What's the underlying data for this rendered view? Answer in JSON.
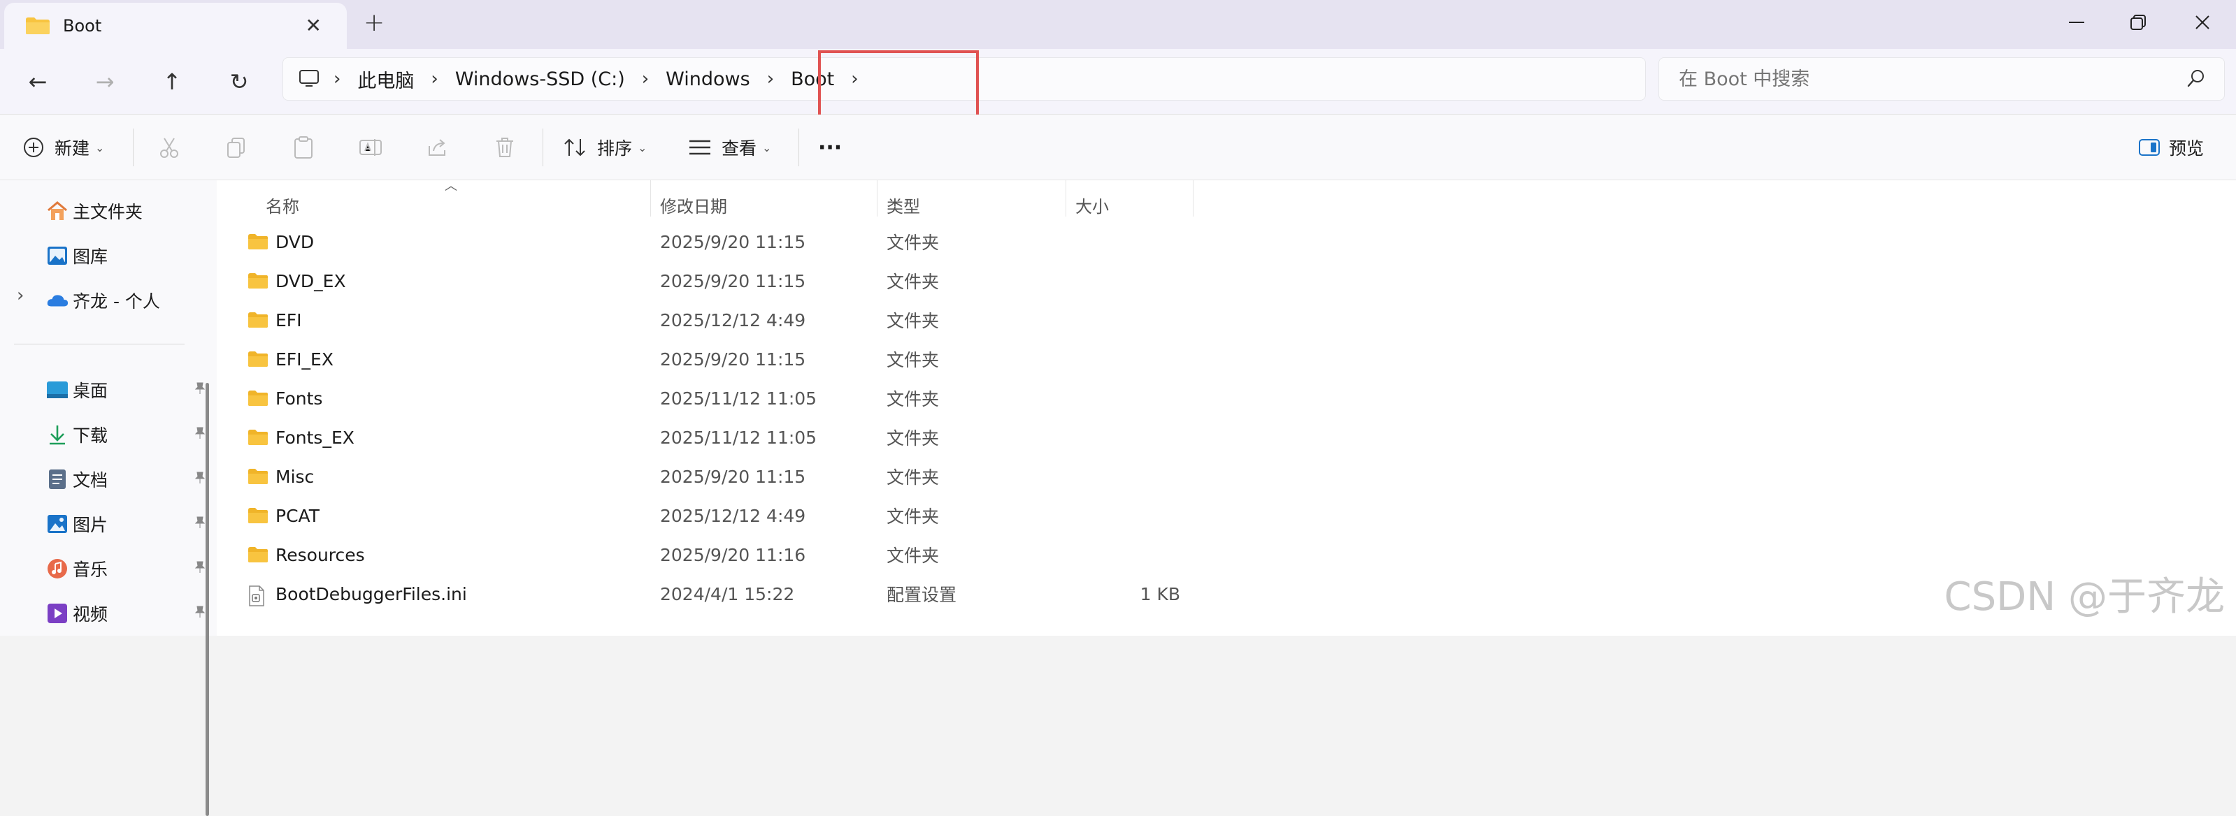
{
  "window": {
    "tab_title": "Boot",
    "close_tab_glyph": "✕",
    "new_tab_glyph": "+",
    "minimize_glyph": "—",
    "maximize_glyph": "❐",
    "close_glyph": "✕"
  },
  "nav": {
    "back_glyph": "←",
    "forward_glyph": "→",
    "up_glyph": "↑",
    "refresh_glyph": "↻"
  },
  "breadcrumb": {
    "items": [
      "此电脑",
      "Windows-SSD (C:)",
      "Windows",
      "Boot"
    ],
    "separator": "›"
  },
  "search": {
    "placeholder": "在 Boot 中搜索"
  },
  "toolbar": {
    "new_label": "新建",
    "sort_label": "排序",
    "view_label": "查看",
    "more_label": "···",
    "preview_label": "预览"
  },
  "sidebar": {
    "items": [
      {
        "label": "主文件夹",
        "icon": "home-icon"
      },
      {
        "label": "图库",
        "icon": "gallery-icon"
      },
      {
        "label": "齐龙 - 个人",
        "icon": "cloud-icon"
      },
      {
        "label": "桌面",
        "icon": "desktop-icon"
      },
      {
        "label": "下载",
        "icon": "download-icon"
      },
      {
        "label": "文档",
        "icon": "documents-icon"
      },
      {
        "label": "图片",
        "icon": "pictures-icon"
      },
      {
        "label": "音乐",
        "icon": "music-icon"
      },
      {
        "label": "视频",
        "icon": "videos-icon"
      }
    ],
    "expand_glyph": "›",
    "pin_glyph": "📌"
  },
  "table": {
    "columns": [
      "名称",
      "修改日期",
      "类型",
      "大小"
    ],
    "rows": [
      {
        "name": "DVD",
        "date": "2025/9/20 11:15",
        "type": "文件夹",
        "size": "",
        "kind": "folder"
      },
      {
        "name": "DVD_EX",
        "date": "2025/9/20 11:15",
        "type": "文件夹",
        "size": "",
        "kind": "folder"
      },
      {
        "name": "EFI",
        "date": "2025/12/12 4:49",
        "type": "文件夹",
        "size": "",
        "kind": "folder"
      },
      {
        "name": "EFI_EX",
        "date": "2025/9/20 11:15",
        "type": "文件夹",
        "size": "",
        "kind": "folder"
      },
      {
        "name": "Fonts",
        "date": "2025/11/12 11:05",
        "type": "文件夹",
        "size": "",
        "kind": "folder"
      },
      {
        "name": "Fonts_EX",
        "date": "2025/11/12 11:05",
        "type": "文件夹",
        "size": "",
        "kind": "folder"
      },
      {
        "name": "Misc",
        "date": "2025/9/20 11:15",
        "type": "文件夹",
        "size": "",
        "kind": "folder"
      },
      {
        "name": "PCAT",
        "date": "2025/12/12 4:49",
        "type": "文件夹",
        "size": "",
        "kind": "folder"
      },
      {
        "name": "Resources",
        "date": "2025/9/20 11:16",
        "type": "文件夹",
        "size": "",
        "kind": "folder"
      },
      {
        "name": "BootDebuggerFiles.ini",
        "date": "2024/4/1 15:22",
        "type": "配置设置",
        "size": "1 KB",
        "kind": "file"
      }
    ]
  },
  "watermark": "CSDN @于齐龙",
  "colors": {
    "folder_yellow": "#f8c440",
    "highlight_red": "#e05252",
    "accent_blue": "#1a73c8"
  }
}
